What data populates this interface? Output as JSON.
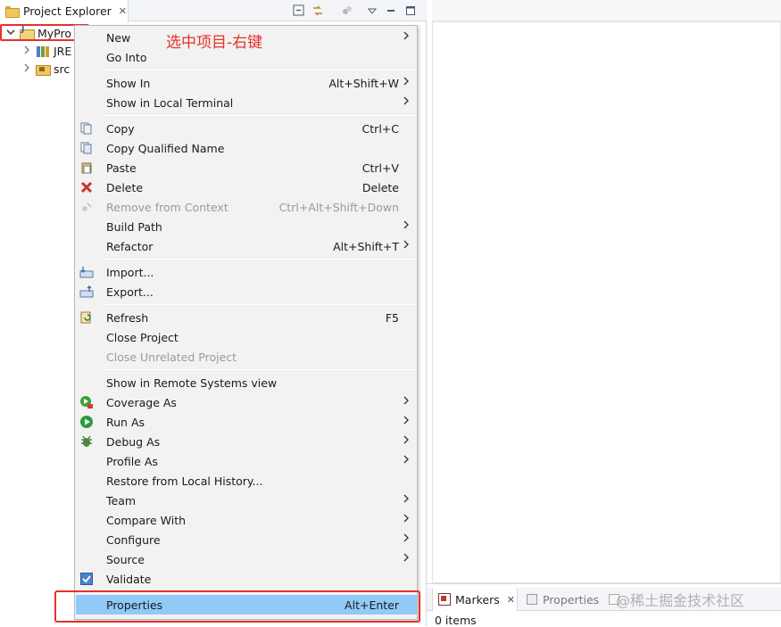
{
  "explorer": {
    "title": "Project Explorer",
    "close_glyph": "✕"
  },
  "tree": {
    "project": "MyPro",
    "children": [
      "JRE",
      "src"
    ]
  },
  "annotation": "选中项目-右键",
  "menu": {
    "items": [
      {
        "label": "New",
        "accel": "",
        "submenu": true,
        "disabled": false,
        "icon": ""
      },
      {
        "label": "Go Into",
        "accel": "",
        "submenu": false,
        "disabled": false,
        "icon": ""
      },
      {
        "label": "Show In",
        "accel": "Alt+Shift+W",
        "submenu": true,
        "disabled": false,
        "icon": ""
      },
      {
        "label": "Show in Local Terminal",
        "accel": "",
        "submenu": true,
        "disabled": false,
        "icon": ""
      },
      {
        "label": "Copy",
        "accel": "Ctrl+C",
        "submenu": false,
        "disabled": false,
        "icon": "copy-icon"
      },
      {
        "label": "Copy Qualified Name",
        "accel": "",
        "submenu": false,
        "disabled": false,
        "icon": "copy-qualified-icon"
      },
      {
        "label": "Paste",
        "accel": "Ctrl+V",
        "submenu": false,
        "disabled": false,
        "icon": "paste-icon"
      },
      {
        "label": "Delete",
        "accel": "Delete",
        "submenu": false,
        "disabled": false,
        "icon": "delete-icon"
      },
      {
        "label": "Remove from Context",
        "accel": "Ctrl+Alt+Shift+Down",
        "submenu": false,
        "disabled": true,
        "icon": "remove-context-icon"
      },
      {
        "label": "Build Path",
        "accel": "",
        "submenu": true,
        "disabled": false,
        "icon": ""
      },
      {
        "label": "Refactor",
        "accel": "Alt+Shift+T",
        "submenu": true,
        "disabled": false,
        "icon": ""
      },
      {
        "label": "Import...",
        "accel": "",
        "submenu": false,
        "disabled": false,
        "icon": "import-icon"
      },
      {
        "label": "Export...",
        "accel": "",
        "submenu": false,
        "disabled": false,
        "icon": "export-icon"
      },
      {
        "label": "Refresh",
        "accel": "F5",
        "submenu": false,
        "disabled": false,
        "icon": "refresh-icon"
      },
      {
        "label": "Close Project",
        "accel": "",
        "submenu": false,
        "disabled": false,
        "icon": ""
      },
      {
        "label": "Close Unrelated Project",
        "accel": "",
        "submenu": false,
        "disabled": true,
        "icon": ""
      },
      {
        "label": "Show in Remote Systems view",
        "accel": "",
        "submenu": false,
        "disabled": false,
        "icon": ""
      },
      {
        "label": "Coverage As",
        "accel": "",
        "submenu": true,
        "disabled": false,
        "icon": "coverage-icon"
      },
      {
        "label": "Run As",
        "accel": "",
        "submenu": true,
        "disabled": false,
        "icon": "run-icon"
      },
      {
        "label": "Debug As",
        "accel": "",
        "submenu": true,
        "disabled": false,
        "icon": "debug-icon"
      },
      {
        "label": "Profile As",
        "accel": "",
        "submenu": true,
        "disabled": false,
        "icon": ""
      },
      {
        "label": "Restore from Local History...",
        "accel": "",
        "submenu": false,
        "disabled": false,
        "icon": ""
      },
      {
        "label": "Team",
        "accel": "",
        "submenu": true,
        "disabled": false,
        "icon": ""
      },
      {
        "label": "Compare With",
        "accel": "",
        "submenu": true,
        "disabled": false,
        "icon": ""
      },
      {
        "label": "Configure",
        "accel": "",
        "submenu": true,
        "disabled": false,
        "icon": ""
      },
      {
        "label": "Source",
        "accel": "",
        "submenu": true,
        "disabled": false,
        "icon": ""
      },
      {
        "label": "Validate",
        "accel": "",
        "submenu": false,
        "disabled": false,
        "icon": "validate-icon"
      },
      {
        "label": "Properties",
        "accel": "Alt+Enter",
        "submenu": false,
        "disabled": false,
        "icon": "",
        "selected": true
      }
    ]
  },
  "bottom": {
    "tabs": [
      "Markers",
      "Properties"
    ],
    "status": "0 items"
  },
  "watermark": "@稀土掘金技术社区"
}
